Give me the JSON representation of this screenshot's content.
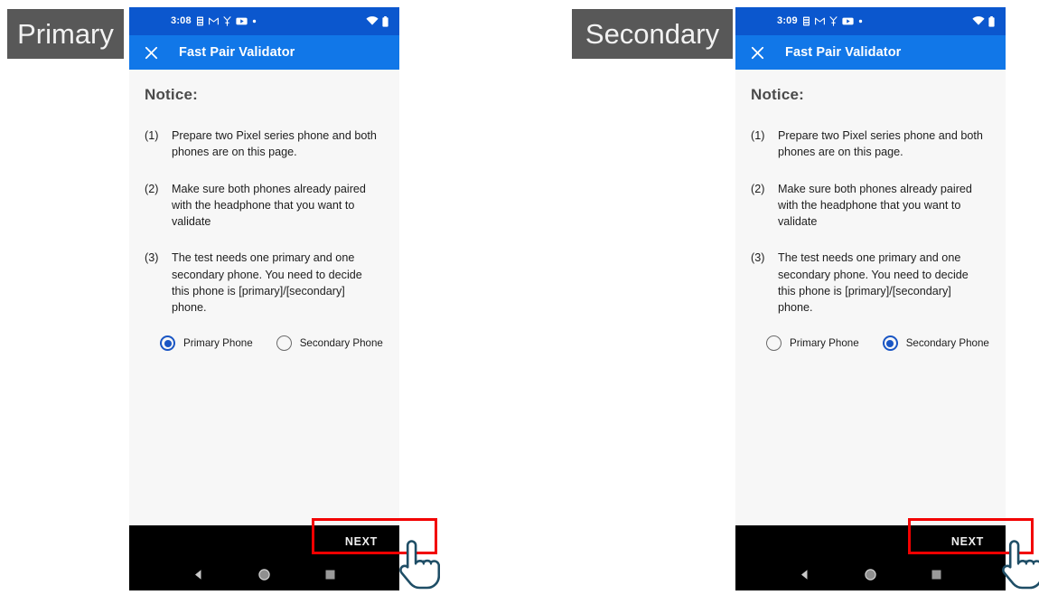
{
  "annotations": {
    "primary_label": "Primary",
    "secondary_label": "Secondary",
    "highlight_color": "#F20000",
    "caption_bg": "#585858"
  },
  "theme": {
    "status_bar_color": "#0B57CE",
    "app_bar_color": "#1177E8",
    "content_bg": "#F7F7F7",
    "accent_color": "#1A56C4",
    "bottom_bar_color": "#000000"
  },
  "phones": [
    {
      "id": "primary",
      "status_bar": {
        "clock": "3:08",
        "icons": [
          "sim-icon",
          "gmail-icon",
          "vpn-key-icon",
          "youtube-icon",
          "dot-icon"
        ],
        "right_icons": [
          "wifi-icon",
          "battery-icon"
        ]
      },
      "app_bar": {
        "close_icon": "close-icon",
        "title": "Fast Pair Validator"
      },
      "content": {
        "heading": "Notice:",
        "items": [
          {
            "num": "(1)",
            "text": "Prepare two Pixel series phone and both phones are on this page."
          },
          {
            "num": "(2)",
            "text": "Make sure both phones already paired with the headphone that you want to validate"
          },
          {
            "num": "(3)",
            "text": "The test needs one primary and one secondary phone. You need to decide this phone is [primary]/[secondary] phone."
          }
        ],
        "radios": [
          {
            "label": "Primary Phone",
            "selected": true
          },
          {
            "label": "Secondary Phone",
            "selected": false
          }
        ]
      },
      "action_bar": {
        "next_label": "NEXT"
      },
      "nav_bar": {
        "icons": [
          "back-icon",
          "home-icon",
          "recents-icon"
        ]
      }
    },
    {
      "id": "secondary",
      "status_bar": {
        "clock": "3:09",
        "icons": [
          "sim-icon",
          "gmail-icon",
          "vpn-key-icon",
          "youtube-icon",
          "dot-icon"
        ],
        "right_icons": [
          "wifi-icon",
          "battery-icon"
        ]
      },
      "app_bar": {
        "close_icon": "close-icon",
        "title": "Fast Pair Validator"
      },
      "content": {
        "heading": "Notice:",
        "items": [
          {
            "num": "(1)",
            "text": "Prepare two Pixel series phone and both phones are on this page."
          },
          {
            "num": "(2)",
            "text": "Make sure both phones already paired with the headphone that you want to validate"
          },
          {
            "num": "(3)",
            "text": "The test needs one primary and one secondary phone. You need to decide this phone is [primary]/[secondary] phone."
          }
        ],
        "radios": [
          {
            "label": "Primary Phone",
            "selected": false
          },
          {
            "label": "Secondary Phone",
            "selected": true
          }
        ]
      },
      "action_bar": {
        "next_label": "NEXT"
      },
      "nav_bar": {
        "icons": [
          "back-icon",
          "home-icon",
          "recents-icon"
        ]
      }
    }
  ]
}
